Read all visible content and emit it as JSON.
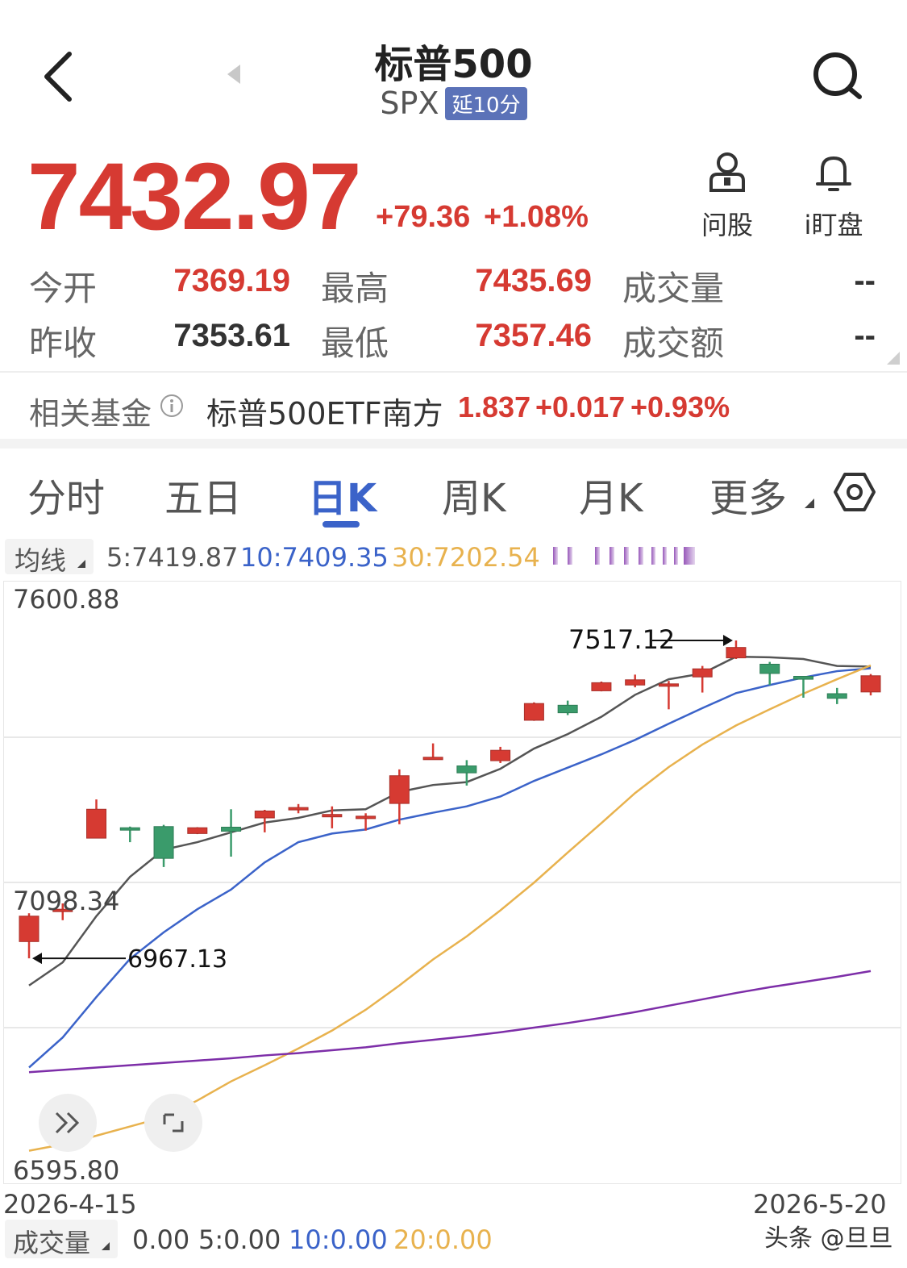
{
  "header": {
    "title": "标普500",
    "code": "SPX",
    "badge": "延10分"
  },
  "quote": {
    "price": "7432.97",
    "change": "+79.36",
    "change_pct": "+1.08%",
    "color_up": "#d63a32",
    "color_down": "#3a9b6b"
  },
  "actions": {
    "ask_label": "问股",
    "watch_label": "i盯盘"
  },
  "stats": {
    "open_label": "今开",
    "open_value": "7369.19",
    "high_label": "最高",
    "high_value": "7435.69",
    "volume_label": "成交量",
    "volume_value": "--",
    "prev_close_label": "昨收",
    "prev_close_value": "7353.61",
    "low_label": "最低",
    "low_value": "7357.46",
    "amount_label": "成交额",
    "amount_value": "--"
  },
  "fund": {
    "label": "相关基金",
    "name": "标普500ETF南方",
    "price": "1.837",
    "change": "+0.017",
    "change_pct": "+0.93%"
  },
  "tabs": [
    {
      "label": "分时"
    },
    {
      "label": "五日"
    },
    {
      "label": "日K"
    },
    {
      "label": "周K"
    },
    {
      "label": "月K"
    },
    {
      "label": "更多"
    }
  ],
  "ma_bar": {
    "button_label": "均线",
    "ma5": "5:7419.87",
    "ma10": "10:7409.35",
    "ma30": "30:7202.54",
    "ma5_color": "#555555",
    "ma10_color": "#3b63c9",
    "ma30_color": "#e8b24e"
  },
  "chart_data": {
    "type": "candlestick",
    "ylim": [
      6595.8,
      7600.88
    ],
    "y_ticks": [
      "7600.88",
      "7098.34",
      "6595.80"
    ],
    "x_start": "2026-4-15",
    "x_end": "2026-5-20",
    "max_annotation": "7517.12",
    "min_annotation": "6967.13",
    "candles": [
      {
        "o": 6996,
        "c": 7040,
        "h": 7045,
        "l": 6967
      },
      {
        "o": 7052,
        "c": 7052,
        "h": 7062,
        "l": 7033
      },
      {
        "o": 7175,
        "c": 7225,
        "h": 7242,
        "l": 7175
      },
      {
        "o": 7193,
        "c": 7190,
        "h": 7195,
        "l": 7168
      },
      {
        "o": 7195,
        "c": 7140,
        "h": 7198,
        "l": 7125
      },
      {
        "o": 7183,
        "c": 7193,
        "h": 7194,
        "l": 7182
      },
      {
        "o": 7194,
        "c": 7187,
        "h": 7225,
        "l": 7143
      },
      {
        "o": 7210,
        "c": 7222,
        "h": 7224,
        "l": 7185
      },
      {
        "o": 7225,
        "c": 7228,
        "h": 7234,
        "l": 7218
      },
      {
        "o": 7216,
        "c": 7216,
        "h": 7230,
        "l": 7192
      },
      {
        "o": 7213,
        "c": 7213,
        "h": 7218,
        "l": 7188
      },
      {
        "o": 7235,
        "c": 7283,
        "h": 7294,
        "l": 7199
      },
      {
        "o": 7315,
        "c": 7315,
        "h": 7339,
        "l": 7312
      },
      {
        "o": 7300,
        "c": 7288,
        "h": 7310,
        "l": 7266
      },
      {
        "o": 7309,
        "c": 7327,
        "h": 7333,
        "l": 7305
      },
      {
        "o": 7379,
        "c": 7408,
        "h": 7410,
        "l": 7378
      },
      {
        "o": 7405,
        "c": 7392,
        "h": 7413,
        "l": 7388
      },
      {
        "o": 7430,
        "c": 7444,
        "h": 7446,
        "l": 7429
      },
      {
        "o": 7440,
        "c": 7449,
        "h": 7458,
        "l": 7436
      },
      {
        "o": 7438,
        "c": 7442,
        "h": 7447,
        "l": 7398
      },
      {
        "o": 7454,
        "c": 7468,
        "h": 7473,
        "l": 7427
      },
      {
        "o": 7487,
        "c": 7505,
        "h": 7517.12,
        "l": 7485
      },
      {
        "o": 7476,
        "c": 7460,
        "h": 7480,
        "l": 7440
      },
      {
        "o": 7455,
        "c": 7450,
        "h": 7455,
        "l": 7418
      },
      {
        "o": 7425,
        "c": 7417,
        "h": 7435,
        "l": 7407
      },
      {
        "o": 7428,
        "c": 7456,
        "h": 7459,
        "l": 7422
      }
    ],
    "series": [
      {
        "values": [
          6920,
          6960,
          7040,
          7108,
          7155,
          7168,
          7185,
          7202,
          7210,
          7223,
          7225,
          7255,
          7267,
          7272,
          7295,
          7330,
          7355,
          7385,
          7423,
          7450,
          7460,
          7489,
          7488,
          7485,
          7473,
          7472
        ],
        "color": "#555555"
      },
      {
        "values": [
          6778,
          6830,
          6900,
          6966,
          7012,
          7052,
          7086,
          7133,
          7168,
          7183,
          7190,
          7207,
          7219,
          7230,
          7247,
          7274,
          7297,
          7320,
          7345,
          7373,
          7400,
          7426,
          7440,
          7453,
          7464,
          7469
        ],
        "color": "#3b63c9"
      },
      {
        "values": [
          6634,
          6645,
          6660,
          6676,
          6692,
          6721,
          6754,
          6782,
          6811,
          6842,
          6878,
          6920,
          6965,
          7005,
          7050,
          7098,
          7150,
          7201,
          7253,
          7298,
          7337,
          7370,
          7398,
          7425,
          7450,
          7474
        ],
        "color": "#e8b24e"
      },
      {
        "values": [
          6770,
          6774,
          6778,
          6782,
          6786,
          6790,
          6794,
          6799,
          6803,
          6808,
          6813,
          6820,
          6826,
          6832,
          6839,
          6847,
          6855,
          6864,
          6874,
          6885,
          6896,
          6907,
          6917,
          6926,
          6935,
          6945
        ],
        "color": "#7d2ea8"
      }
    ]
  },
  "volume": {
    "button_label": "成交量",
    "total": "0.00",
    "ma5": "5:0.00",
    "ma10": "10:0.00",
    "ma20": "20:0.00"
  },
  "watermark": "头条 @旦旦"
}
